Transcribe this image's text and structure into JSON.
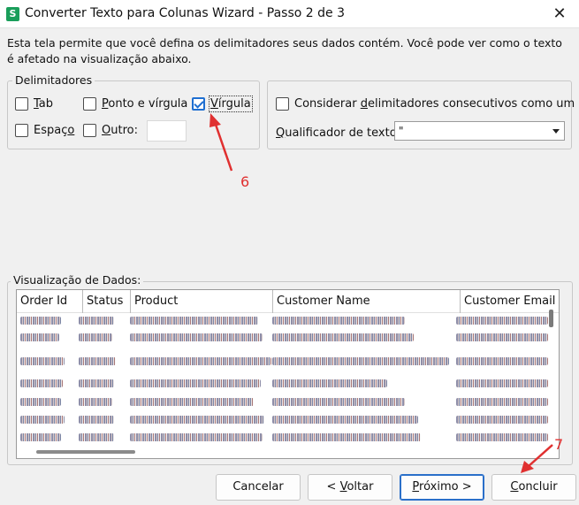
{
  "window": {
    "app_icon_letter": "S",
    "title": "Converter Texto para Colunas Wizard - Passo 2 de 3",
    "close_glyph": "✕"
  },
  "description": "Esta tela permite que você defina os delimitadores seus dados contém. Você pode ver como o texto é afetado na visualização abaixo.",
  "delimiters": {
    "legend": "Delimitadores",
    "tab": {
      "label": "Tab",
      "checked": false
    },
    "semicolon": {
      "label": "Ponto e vírgula",
      "checked": false
    },
    "comma": {
      "label": "Vírgula",
      "checked": true
    },
    "space": {
      "label": "Espaço",
      "checked": false
    },
    "other": {
      "label": "Outro:",
      "checked": false,
      "value": ""
    }
  },
  "options": {
    "consecutive_label": "Considerar delimitadores consecutivos como um só",
    "consecutive_checked": false,
    "qualifier_label": "Qualificador de texto:",
    "qualifier_value": "\""
  },
  "preview": {
    "legend": "Visualização de Dados:",
    "columns": [
      "Order Id",
      "Status",
      "Product",
      "Customer Name",
      "Customer Email"
    ]
  },
  "buttons": {
    "cancel": "Cancelar",
    "back": "< Voltar",
    "next": "Próximo >",
    "finish": "Concluir"
  },
  "annotations": {
    "step6": "6",
    "step7": "7",
    "color": "#e03030"
  },
  "colors": {
    "accent": "#1f6fd1",
    "app_icon": "#1a9e5a"
  }
}
